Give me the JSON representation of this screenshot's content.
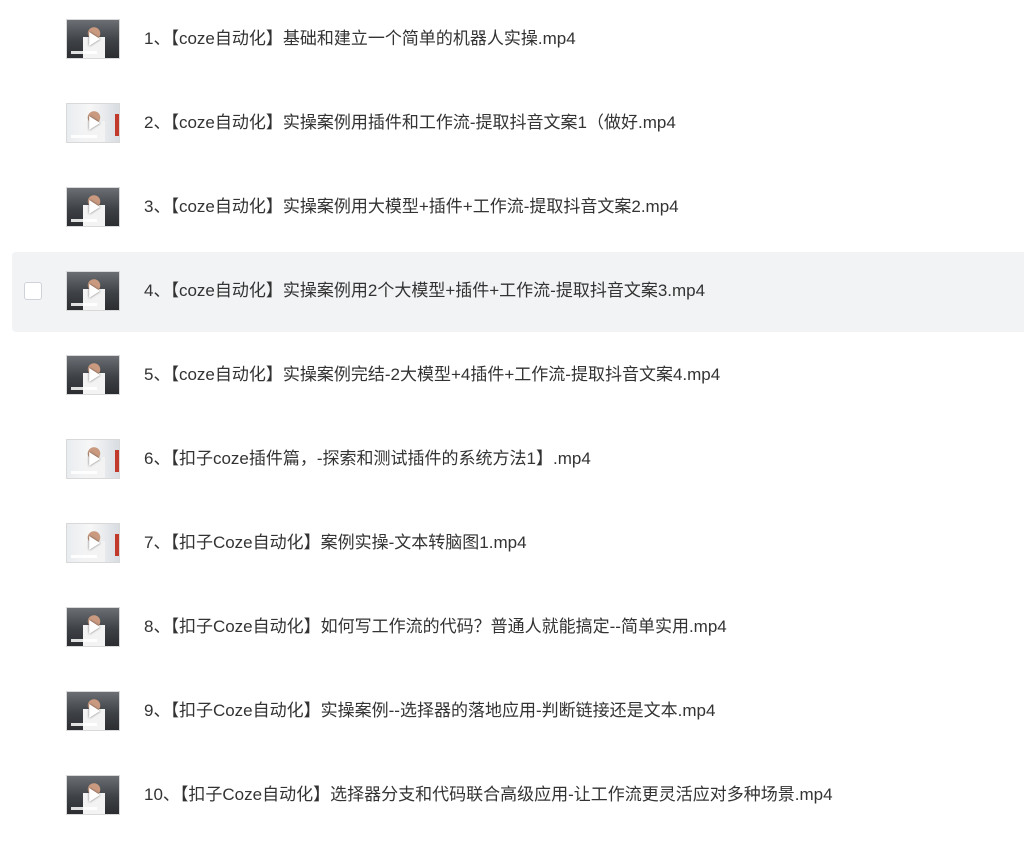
{
  "files": [
    {
      "label": "1、【coze自动化】基础和建立一个简单的机器人实操.mp4",
      "hovered": false,
      "thumb": "dark"
    },
    {
      "label": "2、【coze自动化】实操案例用插件和工作流-提取抖音文案1（做好.mp4",
      "hovered": false,
      "thumb": "light"
    },
    {
      "label": "3、【coze自动化】实操案例用大模型+插件+工作流-提取抖音文案2.mp4",
      "hovered": false,
      "thumb": "dark"
    },
    {
      "label": "4、【coze自动化】实操案例用2个大模型+插件+工作流-提取抖音文案3.mp4",
      "hovered": true,
      "thumb": "dark"
    },
    {
      "label": "5、【coze自动化】实操案例完结-2大模型+4插件+工作流-提取抖音文案4.mp4",
      "hovered": false,
      "thumb": "dark"
    },
    {
      "label": "6、【扣子coze插件篇，-探索和测试插件的系统方法1】.mp4",
      "hovered": false,
      "thumb": "light"
    },
    {
      "label": "7、【扣子Coze自动化】案例实操-文本转脑图1.mp4",
      "hovered": false,
      "thumb": "light"
    },
    {
      "label": "8、【扣子Coze自动化】如何写工作流的代码？普通人就能搞定--简单实用.mp4",
      "hovered": false,
      "thumb": "dark"
    },
    {
      "label": "9、【扣子Coze自动化】实操案例--选择器的落地应用-判断链接还是文本.mp4",
      "hovered": false,
      "thumb": "dark"
    },
    {
      "label": "10、【扣子Coze自动化】选择器分支和代码联合高级应用-让工作流更灵活应对多种场景.mp4",
      "hovered": false,
      "thumb": "dark"
    }
  ],
  "colors": {
    "text": "#333333",
    "hover_bg": "#f2f3f5",
    "checkbox_border": "#cfd3d9"
  },
  "icons": {
    "thumbnail": "video-thumbnail-icon",
    "play": "play-icon",
    "checkbox": "checkbox-icon"
  }
}
